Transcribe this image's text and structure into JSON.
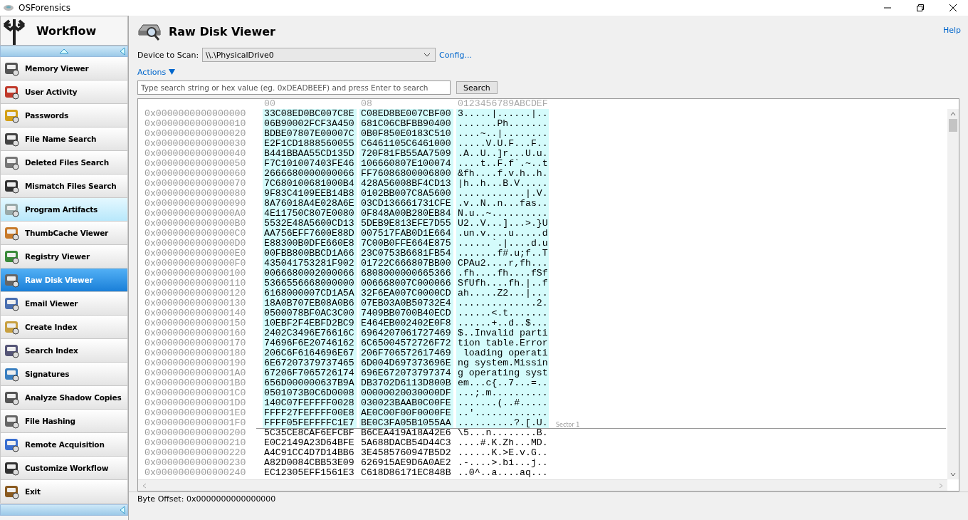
{
  "window": {
    "title": "OSForensics"
  },
  "sidebar": {
    "title": "Workflow",
    "items": [
      {
        "label": "Memory Viewer",
        "selected": false,
        "hovered": false
      },
      {
        "label": "User Activity",
        "selected": false,
        "hovered": false
      },
      {
        "label": "Passwords",
        "selected": false,
        "hovered": false
      },
      {
        "label": "File Name Search",
        "selected": false,
        "hovered": false
      },
      {
        "label": "Deleted Files Search",
        "selected": false,
        "hovered": false
      },
      {
        "label": "Mismatch Files Search",
        "selected": false,
        "hovered": false
      },
      {
        "label": "Program Artifacts",
        "selected": false,
        "hovered": true
      },
      {
        "label": "ThumbCache Viewer",
        "selected": false,
        "hovered": false
      },
      {
        "label": "Registry Viewer",
        "selected": false,
        "hovered": false
      },
      {
        "label": "Raw Disk Viewer",
        "selected": true,
        "hovered": false
      },
      {
        "label": "Email Viewer",
        "selected": false,
        "hovered": false
      },
      {
        "label": "Create Index",
        "selected": false,
        "hovered": false
      },
      {
        "label": "Search Index",
        "selected": false,
        "hovered": false
      },
      {
        "label": "Signatures",
        "selected": false,
        "hovered": false
      },
      {
        "label": "Analyze Shadow Copies",
        "selected": false,
        "hovered": false
      },
      {
        "label": "File Hashing",
        "selected": false,
        "hovered": false
      },
      {
        "label": "Remote Acquisition",
        "selected": false,
        "hovered": false
      },
      {
        "label": "Customize Workflow",
        "selected": false,
        "hovered": false
      },
      {
        "label": "Exit",
        "selected": false,
        "hovered": false
      }
    ]
  },
  "page": {
    "title": "Raw Disk Viewer",
    "help": "Help"
  },
  "device": {
    "label": "Device to Scan:",
    "value": "\\\\.\\PhysicalDrive0",
    "config": "Config..."
  },
  "actions": {
    "label": "Actions"
  },
  "search": {
    "placeholder": "Type search string or hex value (eg. 0xDEADBEEF) and press Enter to search",
    "button": "Search"
  },
  "hex": {
    "headers": [
      "00",
      "08",
      "0123456789ABCDEF"
    ],
    "rows": [
      {
        "offset": "0x0000000000000000",
        "hex1": "33C08ED0BC007C8E",
        "hex2": "C08ED8BE007CBF00",
        "ascii": "3.....|......|..",
        "highlighted": true
      },
      {
        "offset": "0x0000000000000010",
        "hex1": "06B90002FCF3A450",
        "hex2": "681C06CBFBB90400",
        "ascii": ".......Ph.......",
        "highlighted": true
      },
      {
        "offset": "0x0000000000000020",
        "hex1": "BDBE07807E00007C",
        "hex2": "0B0F850E0183C510",
        "ascii": "....~..|........",
        "highlighted": true
      },
      {
        "offset": "0x0000000000000030",
        "hex1": "E2F1CD1888560055",
        "hex2": "C6461105C6461000",
        "ascii": ".....V.U.F...F..",
        "highlighted": true
      },
      {
        "offset": "0x0000000000000040",
        "hex1": "B441BBAA55CD135D",
        "hex2": "720F81FB55AA7509",
        "ascii": ".A..U..]r...U.u.",
        "highlighted": true
      },
      {
        "offset": "0x0000000000000050",
        "hex1": "F7C101007403FE46",
        "hex2": "106660807E100074",
        "ascii": "....t..F.f`.~..t",
        "highlighted": true
      },
      {
        "offset": "0x0000000000000060",
        "hex1": "2666680000000066",
        "hex2": "FF76086800006800",
        "ascii": "&fh....f.v.h..h.",
        "highlighted": true
      },
      {
        "offset": "0x0000000000000070",
        "hex1": "7C680100681000B4",
        "hex2": "428A56008BF4CD13",
        "ascii": "|h..h...B.V.....",
        "highlighted": true
      },
      {
        "offset": "0x0000000000000080",
        "hex1": "9F83C4109EEB14B8",
        "hex2": "0102BB007C8A5600",
        "ascii": "............|.V.",
        "highlighted": true
      },
      {
        "offset": "0x0000000000000090",
        "hex1": "8A76018A4E028A6E",
        "hex2": "03CD136661731CFE",
        "ascii": ".v..N..n...fas..",
        "highlighted": true
      },
      {
        "offset": "0x00000000000000A0",
        "hex1": "4E11750C807E0080",
        "hex2": "0F848A00B280EB84",
        "ascii": "N.u..~..........",
        "highlighted": true
      },
      {
        "offset": "0x00000000000000B0",
        "hex1": "5532E48A5600CD13",
        "hex2": "5DEB9E813EFE7D55",
        "ascii": "U2..V...]...>.}U",
        "highlighted": true
      },
      {
        "offset": "0x00000000000000C0",
        "hex1": "AA756EFF7600E88D",
        "hex2": "007517FAB0D1E664",
        "ascii": ".un.v....u.....d",
        "highlighted": true
      },
      {
        "offset": "0x00000000000000D0",
        "hex1": "E88300B0DFE660E8",
        "hex2": "7C00B0FFE664E875",
        "ascii": "......`.|....d.u",
        "highlighted": true
      },
      {
        "offset": "0x00000000000000E0",
        "hex1": "00FBB800BBCD1A66",
        "hex2": "23C0753B6681FB54",
        "ascii": ".......f#.u;f..T",
        "highlighted": true
      },
      {
        "offset": "0x00000000000000F0",
        "hex1": "435041753281F902",
        "hex2": "01722C666807BB00",
        "ascii": "CPAu2....r,fh...",
        "highlighted": true
      },
      {
        "offset": "0x0000000000000100",
        "hex1": "0066680002000066",
        "hex2": "6808000000665366",
        "ascii": ".fh....fh....fSf",
        "highlighted": true
      },
      {
        "offset": "0x0000000000000110",
        "hex1": "5366556668000000",
        "hex2": "006668007C000066",
        "ascii": "SfUfh....fh.|..f",
        "highlighted": true
      },
      {
        "offset": "0x0000000000000120",
        "hex1": "6168000007CD1A5A",
        "hex2": "32F6EA007C0000CD",
        "ascii": "ah.....Z2...|...",
        "highlighted": true
      },
      {
        "offset": "0x0000000000000130",
        "hex1": "18A0B707EB08A0B6",
        "hex2": "07EB03A0B50732E4",
        "ascii": "..............2.",
        "highlighted": true
      },
      {
        "offset": "0x0000000000000140",
        "hex1": "0500078BF0AC3C00",
        "hex2": "7409BB0700B40ECD",
        "ascii": "......<.t.......",
        "highlighted": true
      },
      {
        "offset": "0x0000000000000150",
        "hex1": "10EBF2F4EBFD2BC9",
        "hex2": "E464EB002402E0F8",
        "ascii": "......+..d..$...",
        "highlighted": true
      },
      {
        "offset": "0x0000000000000160",
        "hex1": "2402C3496E76616C",
        "hex2": "6964207061727469",
        "ascii": "$..Invalid parti",
        "highlighted": true
      },
      {
        "offset": "0x0000000000000170",
        "hex1": "74696F6E20746162",
        "hex2": "6C65004572726F72",
        "ascii": "tion table.Error",
        "highlighted": true
      },
      {
        "offset": "0x0000000000000180",
        "hex1": "206C6F6164696E67",
        "hex2": "206F706572617469",
        "ascii": " loading operati",
        "highlighted": true
      },
      {
        "offset": "0x0000000000000190",
        "hex1": "6E67207379737465",
        "hex2": "6D004D697373696E",
        "ascii": "ng system.Missin",
        "highlighted": true
      },
      {
        "offset": "0x00000000000001A0",
        "hex1": "67206F7065726174",
        "hex2": "696E672073797374",
        "ascii": "g operating syst",
        "highlighted": true
      },
      {
        "offset": "0x00000000000001B0",
        "hex1": "656D000000637B9A",
        "hex2": "DB3702D6113D800B",
        "ascii": "em...c{..7...=..",
        "highlighted": true
      },
      {
        "offset": "0x00000000000001C0",
        "hex1": "0501073B0C6D0008",
        "hex2": "00000020030000DF",
        "ascii": "...;.m..........",
        "highlighted": true
      },
      {
        "offset": "0x00000000000001D0",
        "hex1": "140C07FEFFFF0028",
        "hex2": "030023BAAB0C00FE",
        "ascii": ".......(..#.....",
        "highlighted": true
      },
      {
        "offset": "0x00000000000001E0",
        "hex1": "FFFF27FEFFFF00E8",
        "hex2": "AE0C00F00F0000FE",
        "ascii": "..'.............",
        "highlighted": true
      },
      {
        "offset": "0x00000000000001F0",
        "hex1": "FFFF05FEFFFFC1E7",
        "hex2": "BE0C3FA05B1055AA",
        "ascii": "..........?.[.U.",
        "highlighted": true,
        "sector_label": "Sector 1"
      },
      {
        "offset": "0x0000000000000200",
        "hex1": "5C35CE8CAF6EFCBF",
        "hex2": "B6CEA419A18A42E6",
        "ascii": "\\5...n........B.",
        "highlighted": false
      },
      {
        "offset": "0x0000000000000210",
        "hex1": "E0C2149A23D64BFE",
        "hex2": "5A688DACB54D44C3",
        "ascii": "....#.K.Zh...MD.",
        "highlighted": false
      },
      {
        "offset": "0x0000000000000220",
        "hex1": "A4C91CC4D7D14BB6",
        "hex2": "3E4585760947B5D2",
        "ascii": "......K.>E.v.G..",
        "highlighted": false
      },
      {
        "offset": "0x0000000000000230",
        "hex1": "A82D0084CBB53E09",
        "hex2": "626915AE9D6A0AE2",
        "ascii": ".-....>.bi...j..",
        "highlighted": false
      },
      {
        "offset": "0x0000000000000240",
        "hex1": "EC12305EFF1561E3",
        "hex2": "C618D86171EC848B",
        "ascii": "..0^..a....aq...",
        "highlighted": false
      }
    ]
  },
  "status_bar": {
    "text": "Byte Offset: 0x0000000000000000"
  }
}
